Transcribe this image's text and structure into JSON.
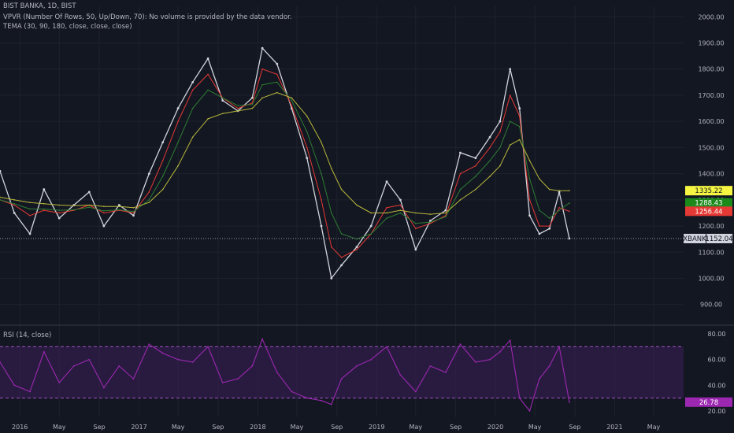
{
  "header": {
    "symbol_line": "BIST BANKA, 1D, BIST",
    "vpvr_line": "VPVR (Number Of Rows, 50, Up/Down, 70): No volume is provided by the data vendor.",
    "tema_line": "TEMA (30, 90, 180, close, close, close)"
  },
  "rsi_header": {
    "label": "RSI (14, close)"
  },
  "colors": {
    "background": "#131722",
    "price": "#d1d4dc",
    "tema_fast": "#e53935",
    "tema_mid": "#2e7d32",
    "tema_slow": "#b8b83a",
    "rsi": "#9c27b0",
    "rsi_band": "#3d1f5a",
    "grid": "#1e222d"
  },
  "chart_data": [
    {
      "type": "line",
      "panel": "price",
      "x": [
        "2015-11-01",
        "2015-12-15",
        "2016-02-01",
        "2016-03-15",
        "2016-05-01",
        "2016-06-15",
        "2016-08-01",
        "2016-09-15",
        "2016-11-01",
        "2016-12-15",
        "2017-02-01",
        "2017-03-15",
        "2017-05-01",
        "2017-06-15",
        "2017-08-01",
        "2017-09-15",
        "2017-11-01",
        "2017-12-15",
        "2018-01-15",
        "2018-03-01",
        "2018-04-15",
        "2018-06-01",
        "2018-07-15",
        "2018-08-15",
        "2018-09-15",
        "2018-11-01",
        "2018-12-15",
        "2019-02-01",
        "2019-03-15",
        "2019-05-01",
        "2019-06-15",
        "2019-08-01",
        "2019-09-15",
        "2019-11-01",
        "2019-12-15",
        "2020-01-15",
        "2020-02-15",
        "2020-03-15",
        "2020-04-15",
        "2020-05-15",
        "2020-06-15",
        "2020-07-15",
        "2020-08-15"
      ],
      "series": [
        {
          "values": [
            1410,
            1250,
            1170,
            1340,
            1230,
            1280,
            1330,
            1200,
            1280,
            1240,
            1400,
            1520,
            1650,
            1750,
            1840,
            1680,
            1640,
            1690,
            1880,
            1820,
            1650,
            1460,
            1200,
            1000,
            1050,
            1120,
            1200,
            1370,
            1300,
            1110,
            1220,
            1260,
            1480,
            1460,
            1540,
            1600,
            1800,
            1650,
            1240,
            1170,
            1190,
            1330,
            1152
          ]
        },
        {
          "values": [
            1300,
            1280,
            1240,
            1260,
            1250,
            1260,
            1280,
            1250,
            1260,
            1250,
            1330,
            1450,
            1600,
            1720,
            1780,
            1690,
            1650,
            1670,
            1800,
            1780,
            1660,
            1500,
            1300,
            1120,
            1080,
            1110,
            1170,
            1270,
            1280,
            1190,
            1210,
            1240,
            1400,
            1430,
            1500,
            1560,
            1700,
            1620,
            1300,
            1200,
            1200,
            1270,
            1256
          ]
        },
        {
          "values": [
            1300,
            1285,
            1265,
            1265,
            1260,
            1262,
            1272,
            1258,
            1262,
            1255,
            1300,
            1390,
            1520,
            1650,
            1720,
            1690,
            1660,
            1665,
            1740,
            1750,
            1680,
            1560,
            1400,
            1250,
            1170,
            1150,
            1170,
            1230,
            1250,
            1210,
            1215,
            1235,
            1340,
            1390,
            1450,
            1500,
            1600,
            1580,
            1380,
            1260,
            1230,
            1260,
            1288
          ]
        },
        {
          "values": [
            1310,
            1300,
            1290,
            1285,
            1280,
            1278,
            1280,
            1275,
            1275,
            1270,
            1290,
            1340,
            1430,
            1540,
            1610,
            1630,
            1640,
            1650,
            1690,
            1710,
            1690,
            1620,
            1520,
            1420,
            1340,
            1280,
            1250,
            1250,
            1260,
            1250,
            1245,
            1250,
            1300,
            1340,
            1390,
            1430,
            1510,
            1530,
            1450,
            1380,
            1340,
            1335,
            1335
          ]
        }
      ],
      "price_labels": {
        "tema_slow": "1335.22",
        "tema_mid": "1288.43",
        "tema_fast": "1256.44",
        "close_symbol": "XBANK",
        "close_value": "1152.04"
      },
      "y_ticks": [
        "2000.00",
        "1900.00",
        "1800.00",
        "1700.00",
        "1600.00",
        "1500.00",
        "1400.00",
        "1300.00",
        "1200.00",
        "1100.00",
        "1000.00",
        "900.00"
      ],
      "ylim": [
        830,
        2040
      ]
    },
    {
      "type": "line",
      "panel": "rsi",
      "x": [
        "2015-11-01",
        "2015-12-15",
        "2016-02-01",
        "2016-03-15",
        "2016-05-01",
        "2016-06-15",
        "2016-08-01",
        "2016-09-15",
        "2016-11-01",
        "2016-12-15",
        "2017-02-01",
        "2017-03-15",
        "2017-05-01",
        "2017-06-15",
        "2017-08-01",
        "2017-09-15",
        "2017-11-01",
        "2017-12-15",
        "2018-01-15",
        "2018-03-01",
        "2018-04-15",
        "2018-06-01",
        "2018-07-15",
        "2018-08-15",
        "2018-09-15",
        "2018-11-01",
        "2018-12-15",
        "2019-02-01",
        "2019-03-15",
        "2019-05-01",
        "2019-06-15",
        "2019-08-01",
        "2019-09-15",
        "2019-11-01",
        "2019-12-15",
        "2020-01-15",
        "2020-02-15",
        "2020-03-15",
        "2020-04-15",
        "2020-05-15",
        "2020-06-15",
        "2020-07-15",
        "2020-08-15"
      ],
      "series": [
        {
          "values": [
            58,
            40,
            35,
            66,
            42,
            55,
            60,
            38,
            55,
            45,
            72,
            65,
            60,
            58,
            70,
            42,
            45,
            55,
            76,
            50,
            35,
            30,
            28,
            25,
            45,
            55,
            60,
            70,
            48,
            35,
            55,
            50,
            72,
            58,
            60,
            66,
            75,
            30,
            20,
            45,
            55,
            70,
            26.78
          ]
        }
      ],
      "levels": [
        70,
        30
      ],
      "last_value": "26.78",
      "y_ticks": [
        "80.00",
        "60.00",
        "40.00",
        "20.00"
      ],
      "ylim": [
        15,
        85
      ]
    }
  ],
  "x_axis": {
    "ticks": [
      {
        "label": "2016",
        "date": "2016-01-01"
      },
      {
        "label": "May",
        "date": "2016-05-01"
      },
      {
        "label": "Sep",
        "date": "2016-09-01"
      },
      {
        "label": "2017",
        "date": "2017-01-01"
      },
      {
        "label": "May",
        "date": "2017-05-01"
      },
      {
        "label": "Sep",
        "date": "2017-09-01"
      },
      {
        "label": "2018",
        "date": "2018-01-01"
      },
      {
        "label": "May",
        "date": "2018-05-01"
      },
      {
        "label": "Sep",
        "date": "2018-09-01"
      },
      {
        "label": "2019",
        "date": "2019-01-01"
      },
      {
        "label": "May",
        "date": "2019-05-01"
      },
      {
        "label": "Sep",
        "date": "2019-09-01"
      },
      {
        "label": "2020",
        "date": "2020-01-01"
      },
      {
        "label": "May",
        "date": "2020-05-01"
      },
      {
        "label": "Sep",
        "date": "2020-09-01"
      },
      {
        "label": "2021",
        "date": "2021-01-01"
      },
      {
        "label": "May",
        "date": "2021-05-01"
      }
    ]
  }
}
